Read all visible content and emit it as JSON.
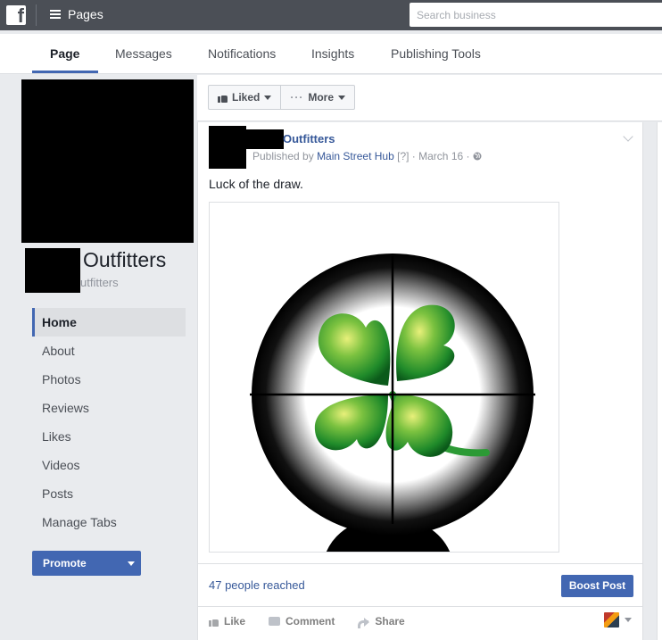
{
  "topbar": {
    "pages_label": "Pages",
    "search_placeholder": "Search business"
  },
  "tabs": [
    {
      "label": "Page",
      "active": true
    },
    {
      "label": "Messages"
    },
    {
      "label": "Notifications"
    },
    {
      "label": "Insights"
    },
    {
      "label": "Publishing Tools"
    }
  ],
  "page": {
    "name": "Outfitters",
    "handle": "utfitters"
  },
  "sidebar": {
    "items": [
      {
        "label": "Home",
        "active": true
      },
      {
        "label": "About"
      },
      {
        "label": "Photos"
      },
      {
        "label": "Reviews"
      },
      {
        "label": "Likes"
      },
      {
        "label": "Videos"
      },
      {
        "label": "Posts"
      },
      {
        "label": "Manage Tabs"
      }
    ],
    "promote_label": "Promote"
  },
  "actions": {
    "liked_label": "Liked",
    "more_label": "More"
  },
  "post": {
    "author": "Outfitters",
    "published_by_prefix": "Published by",
    "published_by_name": "Main Street Hub",
    "help_marker": "[?]",
    "date": "March 16",
    "text": "Luck of the draw.",
    "reach": "47 people reached",
    "boost_label": "Boost Post",
    "like_label": "Like",
    "comment_label": "Comment",
    "share_label": "Share"
  },
  "colors": {
    "accent": "#4267b2",
    "link": "#365899",
    "topbar": "#4b4f56"
  },
  "icons": [
    "facebook-logo-icon",
    "hamburger-icon",
    "thumbs-up-icon",
    "more-dots-icon",
    "chevron-down-icon",
    "globe-icon",
    "comment-icon",
    "share-icon"
  ]
}
